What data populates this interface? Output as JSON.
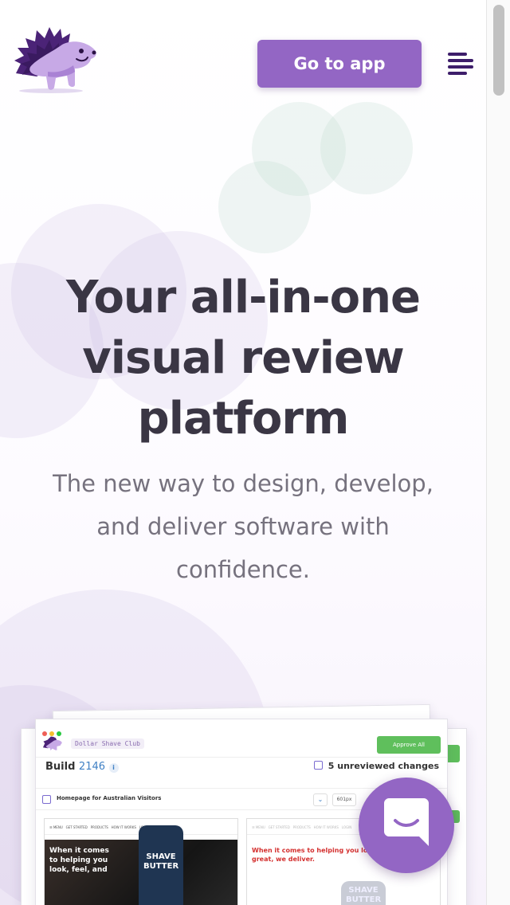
{
  "header": {
    "logo_name": "porcupine-logo",
    "go_to_app_label": "Go to app",
    "menu_icon": "hamburger-menu-icon"
  },
  "hero": {
    "title_line1": "Your all-in-one",
    "title_line2": "visual review",
    "title_line3": "platform",
    "subtitle_line1": "The new way to design, develop,",
    "subtitle_line2": "and deliver software with",
    "subtitle_line3": "confidence."
  },
  "mockup": {
    "project_tag": "Dollar Shave Club",
    "approve_label": "Approve All",
    "build_label": "Build",
    "build_number": "2146",
    "unreviewed_label": "5 unreviewed changes",
    "snapshot_name": "Homepage for Australian Visitors",
    "width_chip": "601px",
    "left_pane_headline": "When it comes to helping you look, feel, and",
    "left_pane_bottle": "SHAVE BUTTER",
    "right_pane_headline": "When it comes to helping you look, feel, and smell great, we deliver.",
    "right_pane_bottle": "SHAVE BUTTER"
  },
  "chat": {
    "icon": "chat-bubble-icon"
  },
  "colors": {
    "brand_purple": "#9366c4",
    "dark_purple": "#3d1d6a",
    "approve_green": "#5fbf5c",
    "title_text": "#3a3644",
    "subtitle_text": "#76727e"
  }
}
